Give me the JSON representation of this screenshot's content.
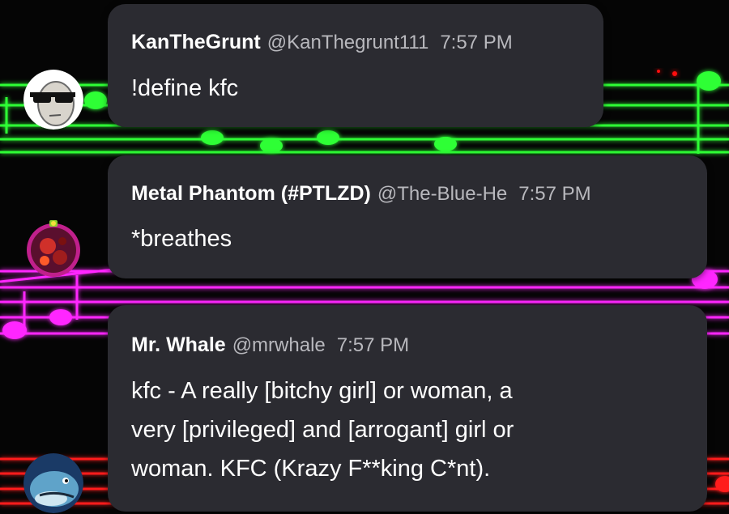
{
  "colors": {
    "bubble": "#2b2b31",
    "name": "#ffffff",
    "meta": "#b8b8bd",
    "body": "#ffffff",
    "staff_green": "#2dff35",
    "staff_magenta": "#ff27ff",
    "staff_red": "#ff1a1a"
  },
  "messages": [
    {
      "author": "KanTheGrunt",
      "handle": "@KanThegrunt111",
      "time": "7:57 PM",
      "text": "!define kfc",
      "avatar_icon": "sunglasses-face-icon"
    },
    {
      "author": "Metal Phantom (#PTLZD)",
      "handle": "@The-Blue-He",
      "time": "7:57 PM",
      "text": "*breathes",
      "avatar_icon": "ornament-icon"
    },
    {
      "author": "Mr. Whale",
      "handle": "@mrwhale",
      "time": "7:57 PM",
      "text_lines": [
        "kfc - A really [bitchy girl] or woman, a",
        "very [privileged] and [arrogant] girl or",
        "woman. KFC (Krazy F**king C*nt)."
      ],
      "avatar_icon": "whale-icon"
    }
  ]
}
